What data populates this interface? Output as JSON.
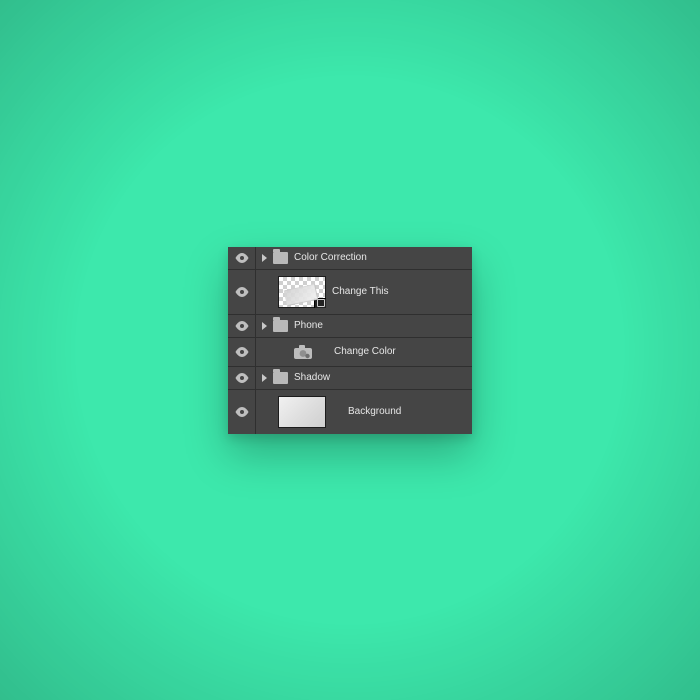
{
  "layers": [
    {
      "name": "Color Correction"
    },
    {
      "name": "Change This"
    },
    {
      "name": "Phone"
    },
    {
      "name": "Change Color"
    },
    {
      "name": "Shadow"
    },
    {
      "name": "Background"
    }
  ]
}
